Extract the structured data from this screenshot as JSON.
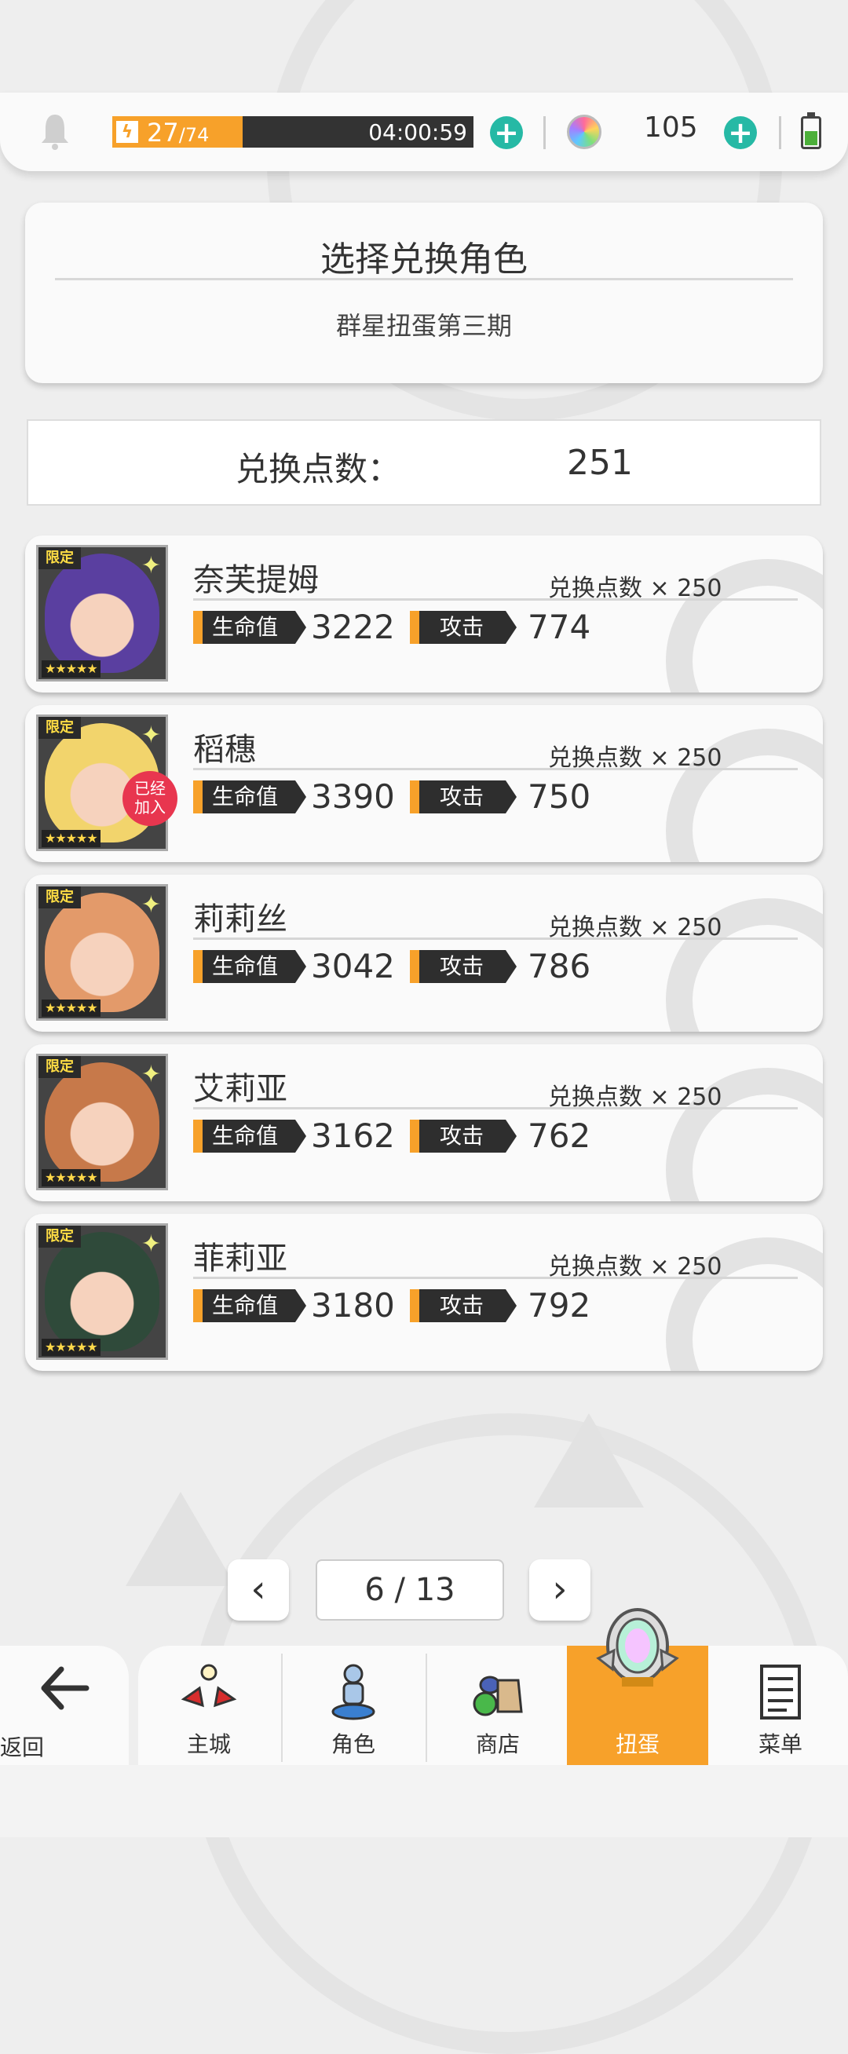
{
  "status_bar": {
    "stamina_current": "27",
    "stamina_max": "74",
    "stamina_fraction": 0.36,
    "stamina_timer": "04:00:59",
    "gem_count": "105",
    "plus_glyph": "+"
  },
  "header": {
    "title": "选择兑换角色",
    "subtitle": "群星扭蛋第三期"
  },
  "points": {
    "label": "兑换点数：",
    "value": "251"
  },
  "cards": [
    {
      "name": "奈芙提姆",
      "cost": "兑换点数 × 250",
      "hp_label": "生命值",
      "hp": "3222",
      "atk_label": "攻击",
      "atk": "774",
      "limited": "限定",
      "stars": "★★★★★",
      "joined": "",
      "color": "#5a3fa0"
    },
    {
      "name": "稻穗",
      "cost": "兑换点数 × 250",
      "hp_label": "生命值",
      "hp": "3390",
      "atk_label": "攻击",
      "atk": "750",
      "limited": "限定",
      "stars": "★★★★★",
      "joined": "已经加入",
      "color": "#f2d46c"
    },
    {
      "name": "莉莉丝",
      "cost": "兑换点数 × 250",
      "hp_label": "生命值",
      "hp": "3042",
      "atk_label": "攻击",
      "atk": "786",
      "limited": "限定",
      "stars": "★★★★★",
      "joined": "",
      "color": "#e39a6a"
    },
    {
      "name": "艾莉亚",
      "cost": "兑换点数 × 250",
      "hp_label": "生命值",
      "hp": "3162",
      "atk_label": "攻击",
      "atk": "762",
      "limited": "限定",
      "stars": "★★★★★",
      "joined": "",
      "color": "#c7794a"
    },
    {
      "name": "菲莉亚",
      "cost": "兑换点数 × 250",
      "hp_label": "生命值",
      "hp": "3180",
      "atk_label": "攻击",
      "atk": "792",
      "limited": "限定",
      "stars": "★★★★★",
      "joined": "",
      "color": "#2f4a3a"
    }
  ],
  "pagination": {
    "current": "6 / 13",
    "prev_glyph": "‹",
    "next_glyph": "›"
  },
  "nav": {
    "back_label": "返回",
    "items": [
      {
        "label": "主城",
        "icon": "castle-icon"
      },
      {
        "label": "角色",
        "icon": "character-icon"
      },
      {
        "label": "商店",
        "icon": "shop-icon"
      },
      {
        "label": "扭蛋",
        "icon": "gacha-icon",
        "active": true
      },
      {
        "label": "菜单",
        "icon": "menu-icon"
      }
    ]
  },
  "colors": {
    "accent_orange": "#f7a12a",
    "plus_teal": "#26b9a5",
    "joined_red": "#e8364f"
  }
}
